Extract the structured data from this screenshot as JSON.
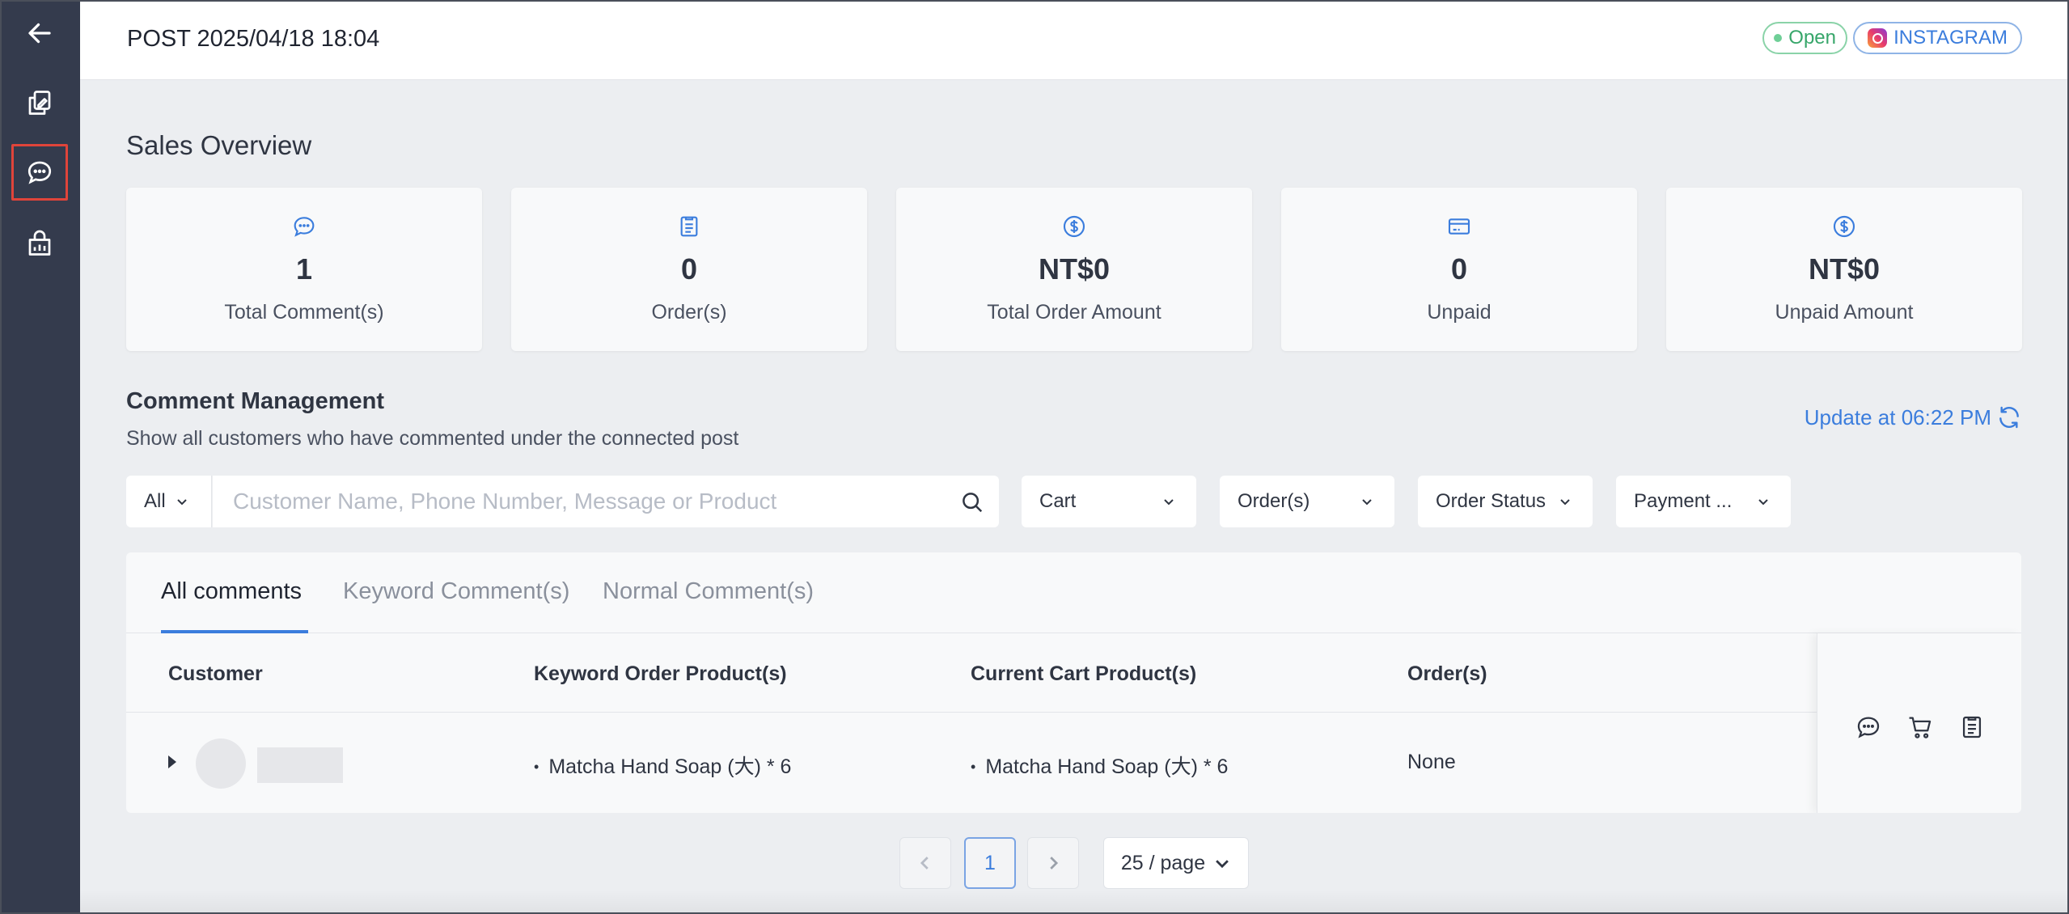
{
  "header": {
    "title": "POST 2025/04/18 18:04",
    "status_badge": "Open",
    "platform_badge": "INSTAGRAM"
  },
  "sidebar": {
    "items": [
      {
        "name": "back",
        "icon": "arrow-left-icon"
      },
      {
        "name": "posts",
        "icon": "copy-edit-icon"
      },
      {
        "name": "comments",
        "icon": "chat-bubble-icon",
        "active": true
      },
      {
        "name": "store",
        "icon": "shop-chart-icon"
      }
    ]
  },
  "sales_overview": {
    "title": "Sales Overview",
    "cards": [
      {
        "icon": "chat-bubble-icon",
        "value": "1",
        "label": "Total Comment(s)"
      },
      {
        "icon": "clipboard-icon",
        "value": "0",
        "label": "Order(s)"
      },
      {
        "icon": "dollar-circle-icon",
        "value": "NT$0",
        "label": "Total Order Amount"
      },
      {
        "icon": "credit-card-icon",
        "value": "0",
        "label": "Unpaid"
      },
      {
        "icon": "dollar-circle-icon",
        "value": "NT$0",
        "label": "Unpaid Amount"
      }
    ]
  },
  "comment_management": {
    "title": "Comment Management",
    "subtitle": "Show all customers who have commented under the connected post",
    "update_label": "Update at 06:22 PM"
  },
  "filters": {
    "scope": "All",
    "search_placeholder": "Customer Name, Phone Number, Message or Product",
    "cart": "Cart",
    "orders": "Order(s)",
    "order_status": "Order Status",
    "payment": "Payment ..."
  },
  "tabs": [
    {
      "label": "All comments",
      "active": true
    },
    {
      "label": "Keyword Comment(s)"
    },
    {
      "label": "Normal Comment(s)"
    }
  ],
  "table": {
    "columns": [
      "Customer",
      "Keyword Order Product(s)",
      "Current Cart Product(s)",
      "Order(s)"
    ],
    "rows": [
      {
        "keyword_product": "Matcha Hand Soap (大) * 6",
        "cart_product": "Matcha Hand Soap (大) * 6",
        "orders": "None"
      }
    ]
  },
  "pagination": {
    "current_page": "1",
    "page_size": "25 / page"
  },
  "colors": {
    "sidebar": "#343b4d",
    "accent": "#3b7ddd",
    "open_green": "#37a66a",
    "active_outline": "#e0443a"
  }
}
